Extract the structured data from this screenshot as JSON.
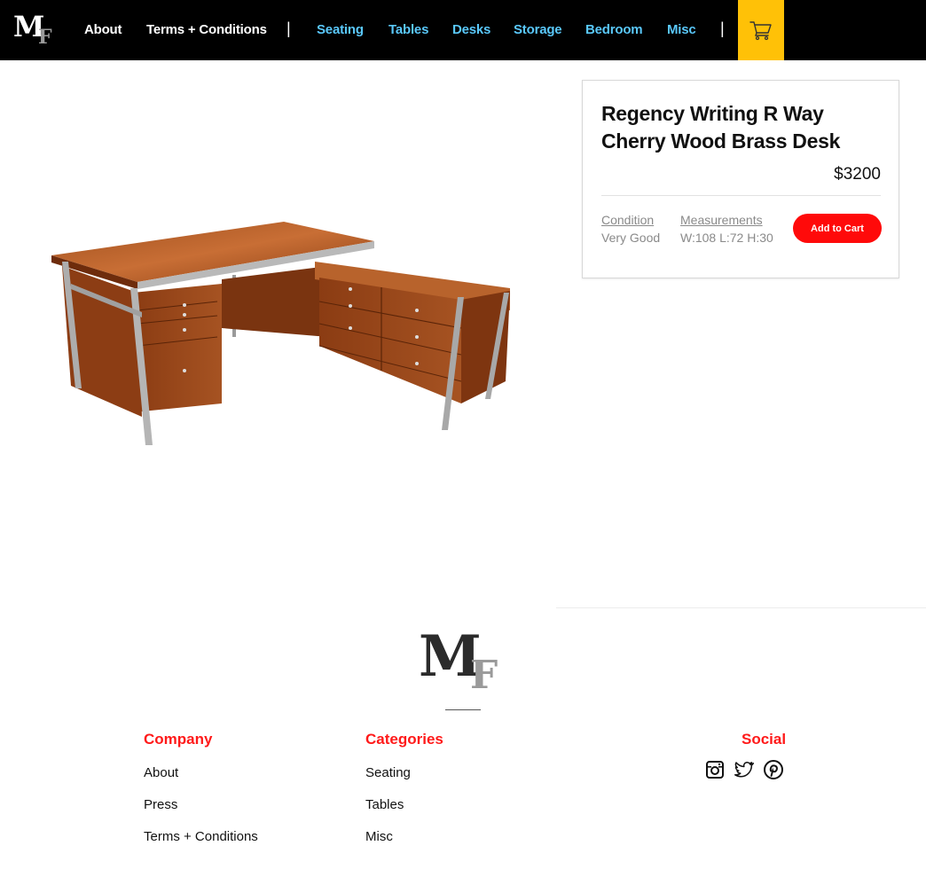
{
  "nav": {
    "logo_text": "MF",
    "links": [
      {
        "label": "About"
      },
      {
        "label": "Terms + Conditions"
      },
      {
        "label": "Seating"
      },
      {
        "label": "Tables"
      },
      {
        "label": "Desks"
      },
      {
        "label": "Storage"
      },
      {
        "label": "Bedroom"
      },
      {
        "label": "Misc"
      }
    ],
    "separator": "|",
    "cart_icon": "shopping-cart-icon",
    "accent_color": "#5ac8fa",
    "cart_color": "#ffc107"
  },
  "product": {
    "title": "Regency Writing R Way Cherry Wood Brass Desk",
    "price": "$3200",
    "condition_label": "Condition",
    "condition_value": "Very Good",
    "measurements_label": "Measurements",
    "measurements_value": "W:108 L:72 H:30",
    "add_to_cart_label": "Add to Cart",
    "button_color": "#ff0a0a"
  },
  "footer": {
    "logo_text": "MF",
    "company": {
      "heading": "Company",
      "links": [
        "About",
        "Press",
        "Terms + Conditions"
      ]
    },
    "categories": {
      "heading": "Categories",
      "links": [
        "Seating",
        "Tables",
        "Misc"
      ]
    },
    "social": {
      "heading": "Social",
      "icons": [
        "instagram-icon",
        "twitter-icon",
        "pinterest-icon"
      ]
    },
    "heading_color": "#ff1a1a"
  }
}
